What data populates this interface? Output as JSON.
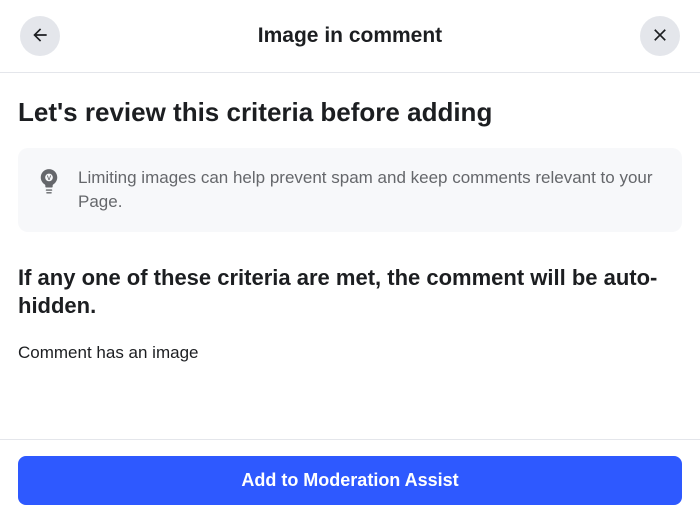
{
  "header": {
    "title": "Image in comment"
  },
  "main": {
    "heading": "Let's review this criteria before adding",
    "info_text": "Limiting images can help prevent spam and keep comments relevant to your Page.",
    "sub_heading": "If any one of these criteria are met, the comment will be auto-hidden.",
    "criteria": {
      "item_0": "Comment has an image"
    }
  },
  "footer": {
    "primary_button_label": "Add to Moderation Assist"
  }
}
